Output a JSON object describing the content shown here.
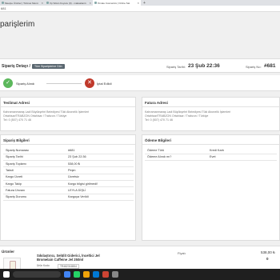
{
  "browser": {
    "tabs": [
      {
        "label": "Meetpe Ürünler | Ticimax Menü"
      },
      {
        "label": "Xp Sıfam Kuyucu (9) - maksalaıntı"
      },
      {
        "label": "Ömate Cosmetics | Online Sat"
      }
    ],
    "new_tab": "+",
    "url": "681"
  },
  "page": {
    "title": "parişlerim"
  },
  "order_header": {
    "title": "Sipariş Detayı /",
    "badge": "Tüm Siparişlerine Dön",
    "date_label": "Sipariş Tarihi:",
    "date": "23 Şub 22:36",
    "no_label": "Sipariş No:",
    "no": "#681"
  },
  "status": {
    "step1": "Sipariş Alındı",
    "step1_icon": "✓",
    "step2": "İptal Edildi",
    "step2_icon": "✕"
  },
  "delivery": {
    "title": "Teslimat Adresi",
    "lines": [
      "Kahramanmaraş Ladi Büyükşehri Belediyesi Tüki Abonelik İşlemleri",
      "Ortahisar/TRABZON Ortahisar / Trabzon / Türkiye",
      "Tel: 0 (507) 470 71 46"
    ]
  },
  "invoice": {
    "title": "Fatura Adresi",
    "lines": [
      "Kahramanmaraş Ladi Büyükşehri Belediyesi Tüki Abonelik İşlemleri",
      "Ortahisar/TRABZON Ortahisar / Trabzon / Türkiye",
      "Tel: 0 (507) 470 71 46"
    ]
  },
  "order_info": {
    "title": "Sipariş Bilgileri",
    "rows": [
      {
        "k": "Sipariş Numarası",
        "v": "#681"
      },
      {
        "k": "Sipariş Tarihi",
        "v": "23 Şub 22:36"
      },
      {
        "k": "Sipariş Toplamı",
        "v": "538,00 ₺"
      },
      {
        "k": "Taksit",
        "v": "Peşin"
      },
      {
        "k": "Kargo Ücreti",
        "v": "Ücretsiz"
      },
      {
        "k": "Kargo Takip",
        "v": "Kargo bilgisi girilmedi!"
      },
      {
        "k": "Fatura Ünvanı",
        "v": "LEYLA DİŞLİ"
      },
      {
        "k": "Sipariş Durumu",
        "v": "Kargoya Verildi"
      }
    ]
  },
  "payment_info": {
    "title": "Ödeme Bilgileri",
    "rows": [
      {
        "k": "Ödeme Türü",
        "v": "Kredi Kartı"
      },
      {
        "k": "Ödeme Alındı mı?",
        "v": "Evet"
      }
    ]
  },
  "products": {
    "title": "Ürünler",
    "name_line1": "Sıkılaştırıcı, Selülit Giderici, İnceltici Jel",
    "name_line2": "Bromelain Caffeine Jel 250ml",
    "code_label": "Ürün Kodu",
    "code_val": "TR482316554",
    "code2_val": "8683071047779",
    "brand_label": "Marka",
    "brand_val": "Ömate",
    "price_label": "Fiyatı",
    "price": "538,00 ₺",
    "discounted": "0"
  },
  "colors": {
    "success": "#5cb85c",
    "cancel": "#c0392b",
    "status_red": "#c0392b",
    "status_green": "#27ae60"
  }
}
